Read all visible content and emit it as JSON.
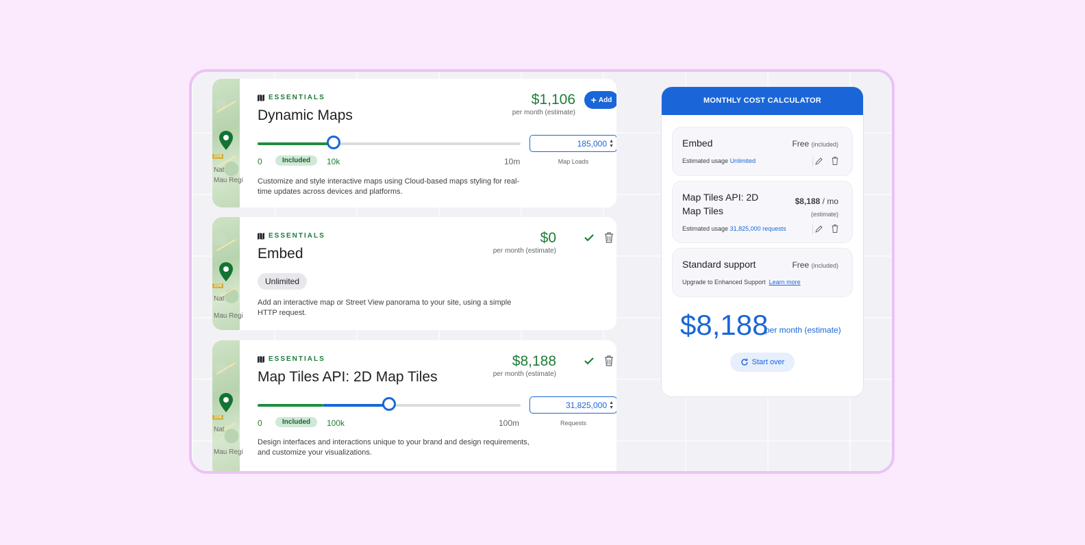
{
  "products": [
    {
      "category": "ESSENTIALS",
      "title": "Dynamic Maps",
      "price": "$1,106",
      "per_month": "per month (estimate)",
      "add_label": "Add",
      "slider_min": "0",
      "included": "Included",
      "slider_included_tick": "10k",
      "slider_max": "10m",
      "slider_level_fraction": 0.29,
      "value": "185,000",
      "unit": "Map Loads",
      "description": "Customize and style interactive maps using Cloud-based maps styling for real-time updates across devices and platforms."
    },
    {
      "category": "ESSENTIALS",
      "title": "Embed",
      "price": "$0",
      "per_month": "per month (estimate)",
      "chip": "Unlimited",
      "description": "Add an interactive map or Street View panorama to your site, using a simple HTTP request."
    },
    {
      "category": "ESSENTIALS",
      "title": "Map Tiles API: 2D Map Tiles",
      "price": "$8,188",
      "per_month": "per month (estimate)",
      "slider_min": "0",
      "included": "Included",
      "slider_included_tick": "100k",
      "slider_max": "100m",
      "slider_level_fraction": 0.5,
      "value": "31,825,000",
      "unit": "Requests",
      "description": "Design interfaces and interactions unique to your brand and design requirements, and customize your visualizations."
    }
  ],
  "map_thumb": {
    "shield": "104",
    "label1": "Nat",
    "label2": "Mau Regi"
  },
  "calculator": {
    "header": "MONTHLY COST CALCULATOR",
    "items": [
      {
        "name": "Embed",
        "amount": "Free",
        "amount_note": "(included)",
        "usage_prefix": "Estimated usage",
        "usage_value": "Unlimited"
      },
      {
        "name": "Map Tiles API: 2D Map Tiles",
        "amount": "$8,188",
        "amount_unit": "/ mo",
        "amount_note": "(estimate)",
        "usage_prefix": "Estimated usage",
        "usage_value": "31,825,000 requests"
      },
      {
        "name": "Standard support",
        "amount": "Free",
        "amount_note": "(included)",
        "upgrade_text": "Upgrade to Enhanced Support",
        "learn_more": "Learn more"
      }
    ],
    "total": "$8,188",
    "total_suffix": "per month (estimate)",
    "start_over": "Start over"
  },
  "colors": {
    "accent_blue": "#1a66d8",
    "price_green": "#1e7d35",
    "page_bg": "#fbe9fd",
    "frame_border": "#ecc3f4"
  }
}
